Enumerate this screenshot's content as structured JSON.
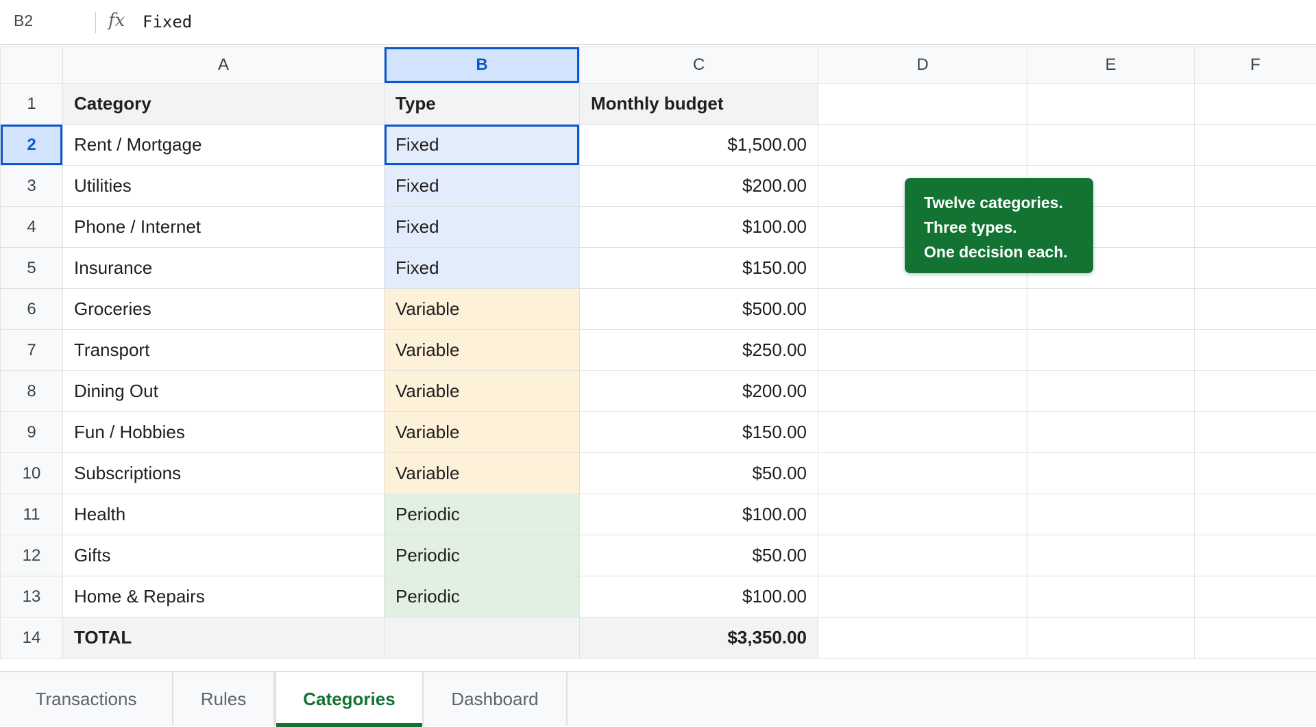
{
  "formula_bar": {
    "cell_ref": "B2",
    "fx_label": "fx",
    "value": "Fixed"
  },
  "columns": [
    "A",
    "B",
    "C",
    "D",
    "E",
    "F"
  ],
  "selected_column": "B",
  "selected_row": "2",
  "header_row": {
    "num": "1",
    "category": "Category",
    "type": "Type",
    "budget": "Monthly budget"
  },
  "rows": [
    {
      "num": "2",
      "category": "Rent / Mortgage",
      "type": "Fixed",
      "budget": "$1,500.00"
    },
    {
      "num": "3",
      "category": "Utilities",
      "type": "Fixed",
      "budget": "$200.00"
    },
    {
      "num": "4",
      "category": "Phone / Internet",
      "type": "Fixed",
      "budget": "$100.00"
    },
    {
      "num": "5",
      "category": "Insurance",
      "type": "Fixed",
      "budget": "$150.00"
    },
    {
      "num": "6",
      "category": "Groceries",
      "type": "Variable",
      "budget": "$500.00"
    },
    {
      "num": "7",
      "category": "Transport",
      "type": "Variable",
      "budget": "$250.00"
    },
    {
      "num": "8",
      "category": "Dining Out",
      "type": "Variable",
      "budget": "$200.00"
    },
    {
      "num": "9",
      "category": "Fun / Hobbies",
      "type": "Variable",
      "budget": "$150.00"
    },
    {
      "num": "10",
      "category": "Subscriptions",
      "type": "Variable",
      "budget": "$50.00"
    },
    {
      "num": "11",
      "category": "Health",
      "type": "Periodic",
      "budget": "$100.00"
    },
    {
      "num": "12",
      "category": "Gifts",
      "type": "Periodic",
      "budget": "$50.00"
    },
    {
      "num": "13",
      "category": "Home & Repairs",
      "type": "Periodic",
      "budget": "$100.00"
    }
  ],
  "total_row": {
    "num": "14",
    "label": "TOTAL",
    "budget": "$3,350.00"
  },
  "note": {
    "lines": [
      "Twelve categories.",
      "Three types.",
      "One decision each."
    ],
    "color": "#137333"
  },
  "type_colors": {
    "Fixed": "#e3ecfb",
    "Variable": "#fef1d9",
    "Periodic": "#e2f0e1"
  },
  "sheet_tabs": [
    {
      "label": "Transactions",
      "active": false
    },
    {
      "label": "Rules",
      "active": false
    },
    {
      "label": "Categories",
      "active": true
    },
    {
      "label": "Dashboard",
      "active": false
    }
  ]
}
